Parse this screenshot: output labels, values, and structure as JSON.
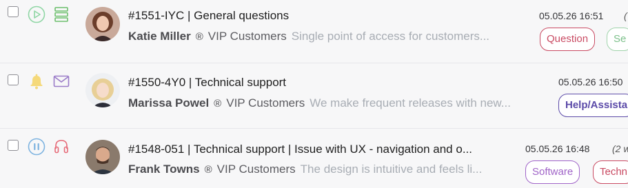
{
  "tickets": [
    {
      "title": "#1551-IYC | General questions",
      "customer": "Katie Miller",
      "reg_mark": "®",
      "group": "VIP Customers",
      "preview": "Single point of access for customers...",
      "date": "05.05.26 16:51",
      "extra": "(",
      "tags": [
        {
          "label": "Question",
          "color": "#c94a62"
        },
        {
          "label": "Se",
          "color": "#7cc08a"
        }
      ],
      "icons": [
        "play-icon",
        "server-icon"
      ]
    },
    {
      "title": "#1550-4Y0 | Technical support",
      "customer": "Marissa Powel",
      "reg_mark": "®",
      "group": "VIP Customers",
      "preview": "We make frequent releases with new...",
      "date": "05.05.26 16:50",
      "extra": "",
      "tags": [
        {
          "label": "Help/Assista",
          "color": "#5b4aa8"
        }
      ],
      "icons": [
        "bell-icon",
        "mail-icon"
      ]
    },
    {
      "title": "#1548-051 | Technical support  | Issue with UX - navigation and o...",
      "customer": "Frank Towns",
      "reg_mark": "®",
      "group": "VIP Customers",
      "preview": "The design is intuitive and feels li...",
      "date": "05.05.26 16:48",
      "extra": "(2 w",
      "tags": [
        {
          "label": "Software",
          "color": "#a064c8"
        },
        {
          "label": "Techn",
          "color": "#c94a62"
        }
      ],
      "icons": [
        "pause-icon",
        "headset-icon"
      ]
    }
  ]
}
